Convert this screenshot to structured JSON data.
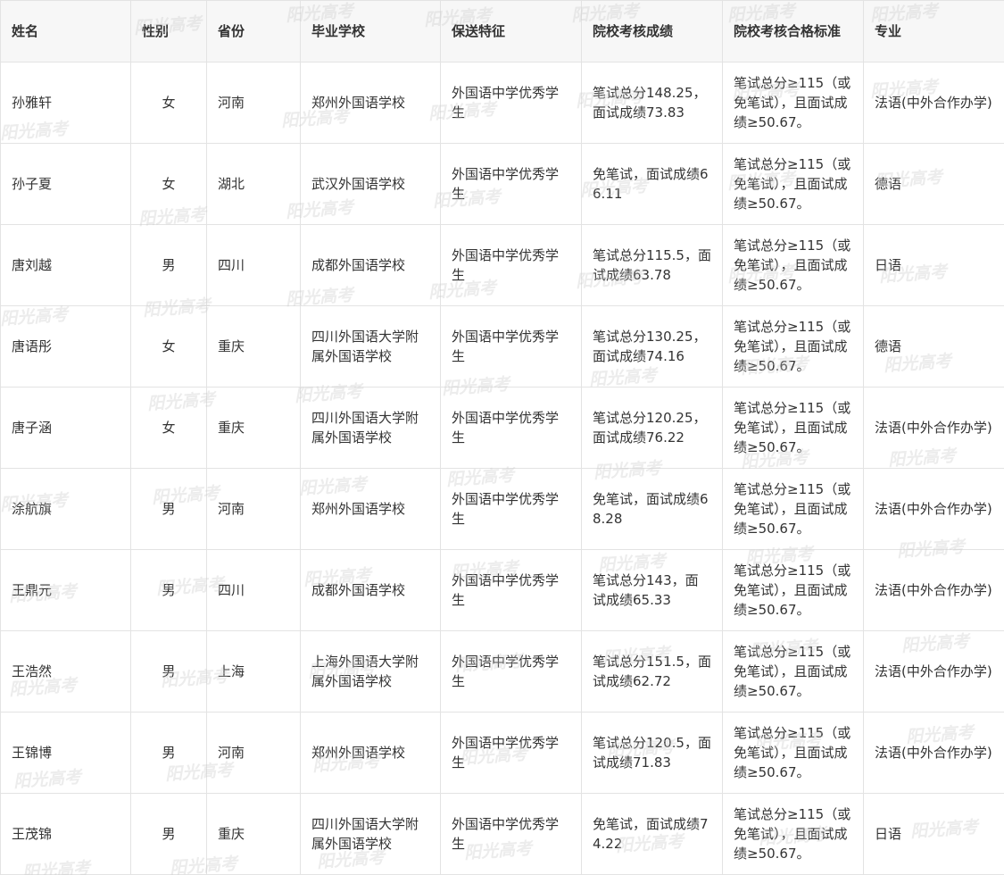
{
  "watermark_text": "阳光高考",
  "table": {
    "headers": [
      "姓名",
      "性别",
      "省份",
      "毕业学校",
      "保送特征",
      "院校考核成绩",
      "院校考核合格标准",
      "专业"
    ],
    "rows": [
      [
        "孙雅轩",
        "女",
        "河南",
        "郑州外国语学校",
        "外国语中学优秀学生",
        "笔试总分148.25，面试成绩73.83",
        "笔试总分≥115（或免笔试），且面试成绩≥50.67。",
        "法语(中外合作办学)"
      ],
      [
        "孙子夏",
        "女",
        "湖北",
        "武汉外国语学校",
        "外国语中学优秀学生",
        "免笔试，面试成绩66.11",
        "笔试总分≥115（或免笔试），且面试成绩≥50.67。",
        "德语"
      ],
      [
        "唐刘越",
        "男",
        "四川",
        "成都外国语学校",
        "外国语中学优秀学生",
        "笔试总分115.5，面试成绩63.78",
        "笔试总分≥115（或免笔试），且面试成绩≥50.67。",
        "日语"
      ],
      [
        "唐语彤",
        "女",
        "重庆",
        "四川外国语大学附属外国语学校",
        "外国语中学优秀学生",
        "笔试总分130.25，面试成绩74.16",
        "笔试总分≥115（或免笔试），且面试成绩≥50.67。",
        "德语"
      ],
      [
        "唐子涵",
        "女",
        "重庆",
        "四川外国语大学附属外国语学校",
        "外国语中学优秀学生",
        "笔试总分120.25，面试成绩76.22",
        "笔试总分≥115（或免笔试），且面试成绩≥50.67。",
        "法语(中外合作办学)"
      ],
      [
        "涂航旗",
        "男",
        "河南",
        "郑州外国语学校",
        "外国语中学优秀学生",
        "免笔试，面试成绩68.28",
        "笔试总分≥115（或免笔试），且面试成绩≥50.67。",
        "法语(中外合作办学)"
      ],
      [
        "王鼎元",
        "男",
        "四川",
        "成都外国语学校",
        "外国语中学优秀学生",
        "笔试总分143，面试成绩65.33",
        "笔试总分≥115（或免笔试），且面试成绩≥50.67。",
        "法语(中外合作办学)"
      ],
      [
        "王浩然",
        "男",
        "上海",
        "上海外国语大学附属外国语学校",
        "外国语中学优秀学生",
        "笔试总分151.5，面试成绩62.72",
        "笔试总分≥115（或免笔试），且面试成绩≥50.67。",
        "法语(中外合作办学)"
      ],
      [
        "王锦博",
        "男",
        "河南",
        "郑州外国语学校",
        "外国语中学优秀学生",
        "笔试总分120.5，面试成绩71.83",
        "笔试总分≥115（或免笔试），且面试成绩≥50.67。",
        "法语(中外合作办学)"
      ],
      [
        "王茂锦",
        "男",
        "重庆",
        "四川外国语大学附属外国语学校",
        "外国语中学优秀学生",
        "免笔试，面试成绩74.22",
        "笔试总分≥115（或免笔试），且面试成绩≥50.67。",
        "日语"
      ]
    ]
  }
}
